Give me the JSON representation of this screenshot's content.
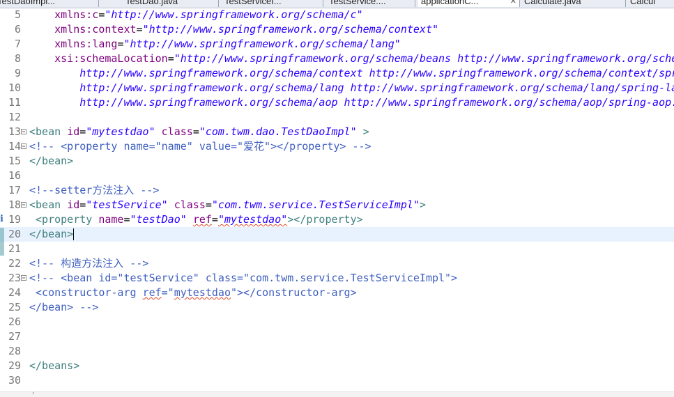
{
  "tabs": [
    {
      "label": "TestDaoImpl...",
      "active": false
    },
    {
      "label": "TestDao.java",
      "active": false
    },
    {
      "label": "TestServiceI...",
      "active": false
    },
    {
      "label": "TestService....",
      "active": false
    },
    {
      "label": "applicationC...",
      "active": true
    },
    {
      "label": "Calculate.java",
      "active": false
    },
    {
      "label": "Calcul",
      "active": false
    }
  ],
  "colors": {
    "tag": "#3f7f7f",
    "attribute": "#7f007f",
    "string": "#2a00ff",
    "comment": "#3f5fbf",
    "current_line": "#e8f2fe"
  },
  "editor": {
    "current_line": 20,
    "lines": [
      {
        "n": "5",
        "tokens": [
          [
            "t-blk",
            "    "
          ],
          [
            "t-attr",
            "xmlns:c"
          ],
          [
            "t-blk",
            "="
          ],
          [
            "t-str",
            "\"http://www.springframework.org/schema/c\""
          ]
        ]
      },
      {
        "n": "6",
        "tokens": [
          [
            "t-blk",
            "    "
          ],
          [
            "t-attr",
            "xmlns:context"
          ],
          [
            "t-blk",
            "="
          ],
          [
            "t-str",
            "\"http://www.springframework.org/schema/context\""
          ]
        ]
      },
      {
        "n": "7",
        "tokens": [
          [
            "t-blk",
            "    "
          ],
          [
            "t-attr",
            "xmlns:lang"
          ],
          [
            "t-blk",
            "="
          ],
          [
            "t-str",
            "\"http://www.springframework.org/schema/lang\""
          ]
        ]
      },
      {
        "n": "8",
        "tokens": [
          [
            "t-blk",
            "    "
          ],
          [
            "t-attr",
            "xsi:schemaLocation"
          ],
          [
            "t-blk",
            "="
          ],
          [
            "t-str",
            "\"http://www.springframework.org/schema/beans http://www.springframework.org/schema/beans/spring-beans.xsd"
          ]
        ]
      },
      {
        "n": "9",
        "tokens": [
          [
            "t-str",
            "        http://www.springframework.org/schema/context http://www.springframework.org/schema/context/spring-context.xsd"
          ]
        ]
      },
      {
        "n": "10",
        "tokens": [
          [
            "t-str",
            "        http://www.springframework.org/schema/lang http://www.springframework.org/schema/lang/spring-lang.xsd"
          ]
        ]
      },
      {
        "n": "11",
        "tokens": [
          [
            "t-str",
            "        http://www.springframework.org/schema/aop http://www.springframework.org/schema/aop/spring-aop.xsd\">"
          ]
        ]
      },
      {
        "n": "12",
        "tokens": []
      },
      {
        "n": "13",
        "fold": true,
        "tokens": [
          [
            "t-tag",
            "<bean "
          ],
          [
            "t-attr",
            "id"
          ],
          [
            "t-blk",
            "="
          ],
          [
            "t-str",
            "\"mytestdao\""
          ],
          [
            "t-blk",
            " "
          ],
          [
            "t-attr",
            "class"
          ],
          [
            "t-blk",
            "="
          ],
          [
            "t-str",
            "\"com.twm.dao.TestDaoImpl\""
          ],
          [
            "t-tag",
            " >"
          ]
        ]
      },
      {
        "n": "14",
        "fold": true,
        "tokens": [
          [
            "t-cm",
            "<!-- <property name=\"name\" value=\"爱花\"></property> -->"
          ]
        ]
      },
      {
        "n": "15",
        "tokens": [
          [
            "t-tag",
            "</bean>"
          ]
        ]
      },
      {
        "n": "16",
        "tokens": []
      },
      {
        "n": "17",
        "tokens": [
          [
            "t-cm",
            "<!--setter方法注入 -->"
          ]
        ]
      },
      {
        "n": "18",
        "fold": true,
        "tokens": [
          [
            "t-tag",
            "<bean "
          ],
          [
            "t-attr",
            "id"
          ],
          [
            "t-blk",
            "="
          ],
          [
            "t-str",
            "\"testService\""
          ],
          [
            "t-blk",
            " "
          ],
          [
            "t-attr",
            "class"
          ],
          [
            "t-blk",
            "="
          ],
          [
            "t-str",
            "\"com.twm.service.TestServiceImpl\""
          ],
          [
            "t-tag",
            ">"
          ]
        ]
      },
      {
        "n": "19",
        "marker": true,
        "tokens": [
          [
            "t-tag",
            " <property "
          ],
          [
            "t-attr",
            "name"
          ],
          [
            "t-blk",
            "="
          ],
          [
            "t-str",
            "\"testDao\""
          ],
          [
            "t-blk",
            " "
          ],
          [
            "t-attr",
            "ref",
            "squig"
          ],
          [
            "t-blk",
            "="
          ],
          [
            "t-str",
            "\"mytestdao\"",
            "squig"
          ],
          [
            "t-tag",
            "></property>"
          ]
        ]
      },
      {
        "n": "20",
        "caret": true,
        "tokens": [
          [
            "t-tag",
            "</bean>"
          ]
        ]
      },
      {
        "n": "21",
        "tokens": []
      },
      {
        "n": "22",
        "tokens": [
          [
            "t-cm",
            "<!-- 构造方法注入 -->"
          ]
        ]
      },
      {
        "n": "23",
        "fold": true,
        "tokens": [
          [
            "t-cm",
            "<!-- <bean id=\"testService\" class=\"com.twm.service.TestServiceImpl\">"
          ]
        ]
      },
      {
        "n": "24",
        "tokens": [
          [
            "t-cm",
            " <constructor-arg "
          ],
          [
            "t-cm",
            "ref",
            "squig"
          ],
          [
            "t-cm",
            "=\""
          ],
          [
            "t-cm",
            "mytestdao",
            "squig"
          ],
          [
            "t-cm",
            "\"></constructor-arg>"
          ]
        ]
      },
      {
        "n": "25",
        "tokens": [
          [
            "t-cm",
            "</bean> -->"
          ]
        ]
      },
      {
        "n": "26",
        "tokens": []
      },
      {
        "n": "27",
        "tokens": []
      },
      {
        "n": "28",
        "tokens": []
      },
      {
        "n": "29",
        "tokens": [
          [
            "t-tag",
            "</beans>"
          ]
        ]
      },
      {
        "n": "30",
        "tokens": []
      }
    ]
  },
  "icons": {
    "fold": "fold-collapse-icon",
    "info": "info-marker-icon",
    "scroll_left": "scroll-left-arrow-icon"
  }
}
